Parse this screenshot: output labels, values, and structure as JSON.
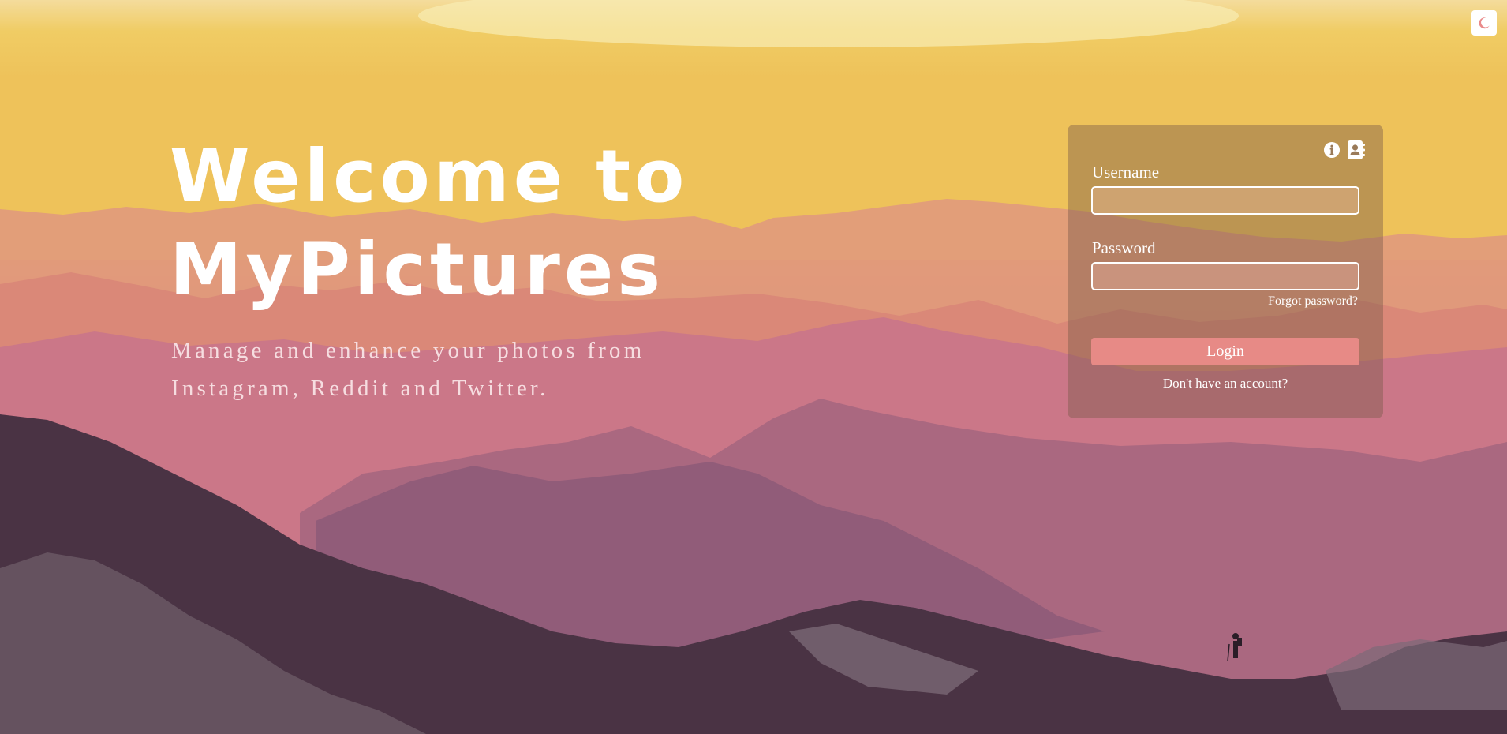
{
  "theme": {
    "toggle_icon": "moon-icon",
    "accent": "#e78a86"
  },
  "hero": {
    "title_line1": "Welcome to",
    "title_line2": "MyPictures",
    "subtitle_line1": "Manage and enhance your photos from",
    "subtitle_line2": "Instagram, Reddit and Twitter."
  },
  "login": {
    "info_icon": "info-icon",
    "contact_icon": "address-book-icon",
    "username_label": "Username",
    "username_value": "",
    "password_label": "Password",
    "password_value": "",
    "forgot_password": "Forgot password?",
    "login_button": "Login",
    "signup_link": "Don't have an account?"
  }
}
